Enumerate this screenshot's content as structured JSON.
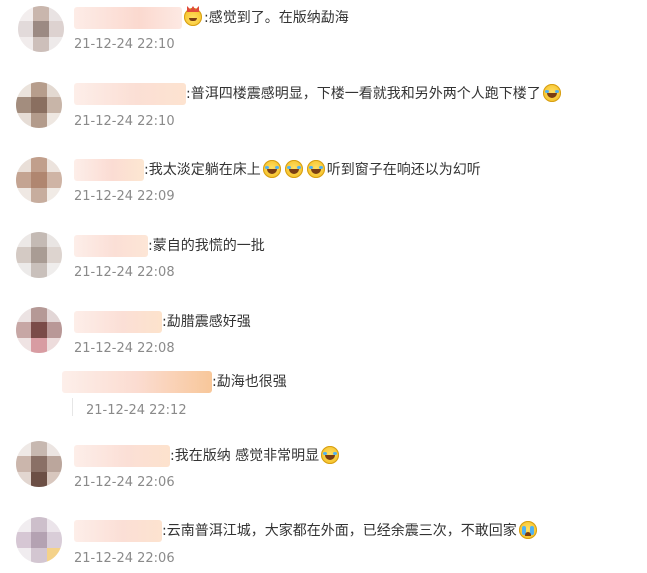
{
  "comments": [
    {
      "text": ":感觉到了。在版纳勐海",
      "time": "21-12-24 22:10",
      "emoji": "crown-icon",
      "emoji_after": "",
      "name_color": "#fde3dc"
    },
    {
      "text": ":普洱四楼震感明显，下楼一看就我和另外两个人跑下楼了",
      "time": "21-12-24 22:10",
      "emoji": "",
      "emoji_after": "laugh-cry-icon",
      "name_color": "#fde6de"
    },
    {
      "text": ":我太淡定躺在床上",
      "text2": "听到窗子在响还以为幻听",
      "time": "21-12-24 22:09",
      "name_color": "#fbe3dc"
    },
    {
      "text": ":蒙自的我慌的一批",
      "time": "21-12-24 22:08",
      "name_color": "#fde8e2"
    },
    {
      "text": ":勐腊震感好强",
      "time": "21-12-24 22:08",
      "name_color": "#fbe6df"
    },
    {
      "text": ":勐海也很强",
      "time": "21-12-24 22:12",
      "name_color": "#fde2d6"
    },
    {
      "text": ":我在版纳 感觉非常明显",
      "time": "21-12-24 22:06",
      "name_color": "#fde8e2"
    },
    {
      "text": ":云南普洱江城，大家都在外面，已经余震三次，不敢回家",
      "time": "21-12-24 22:06",
      "name_color": "#fce6e0"
    }
  ],
  "colors": {
    "time": "#8a8a8a",
    "text": "#333333",
    "background": "#ffffff"
  }
}
